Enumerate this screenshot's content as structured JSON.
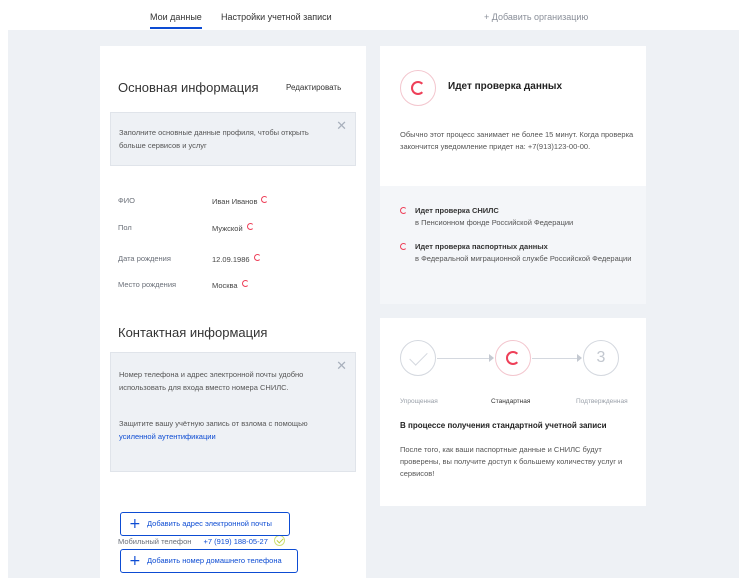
{
  "nav": {
    "tab_my_data": "Мои данные",
    "tab_account_settings": "Настройки учетной записи",
    "add_organization": "+ Добавить организацию"
  },
  "basic": {
    "title": "Основная информация",
    "edit_label": "Редактировать",
    "notice": "Заполните основные данные профиля, чтобы открыть больше сервисов и услуг",
    "fields": [
      {
        "label": "ФИО",
        "value": "Иван Иванов"
      },
      {
        "label": "Пол",
        "value": "Мужской"
      },
      {
        "label": "Дата рождения",
        "value": "12.09.1986"
      },
      {
        "label": "Место рождения",
        "value": "Москва"
      }
    ]
  },
  "contacts": {
    "title": "Контактная информация",
    "notice_1": "Номер телефона и адрес электронной почты удобно использовать для входа вместо номера СНИЛС.",
    "notice_2_text": "Защитите вашу учётную запись от взлома с помощью",
    "notice_2_link": "усиленной аутентификации",
    "mobile_label": "Мобильный телефон",
    "mobile_value": "+7 (919) 188-05-27",
    "add_email": "Добавить адрес электронной почты",
    "add_home_phone": "Добавить номер домашнего телефона"
  },
  "verification": {
    "title": "Идет проверка данных",
    "description": "Обычно этот процесс занимает не более 15 минут. Когда проверка закончится уведомление придет на: +7(913)123-00-00.",
    "items": [
      {
        "title": "Идет проверка СНИЛС",
        "subtitle": "в Пенсионном фонде Российской Федерации"
      },
      {
        "title": "Идет проверка паспортных данных",
        "subtitle": "в Федеральной миграционной службе Российской Федерации"
      }
    ]
  },
  "account_level": {
    "steps": [
      {
        "label": "Упрощенная",
        "status": "done"
      },
      {
        "label": "Стандартная",
        "status": "current"
      },
      {
        "label": "Подтвержденная",
        "status": "pending",
        "number": "3"
      }
    ],
    "title": "В процессе получения стандартной учетной записи",
    "description": "После того, как ваши паспортные данные и СНИЛС будут проверены, вы получите доступ к большему количеству услуг и сервисов!"
  },
  "colors": {
    "accent": "#0d4cd3",
    "pending": "#ee3f58",
    "background": "#eef1f5"
  }
}
